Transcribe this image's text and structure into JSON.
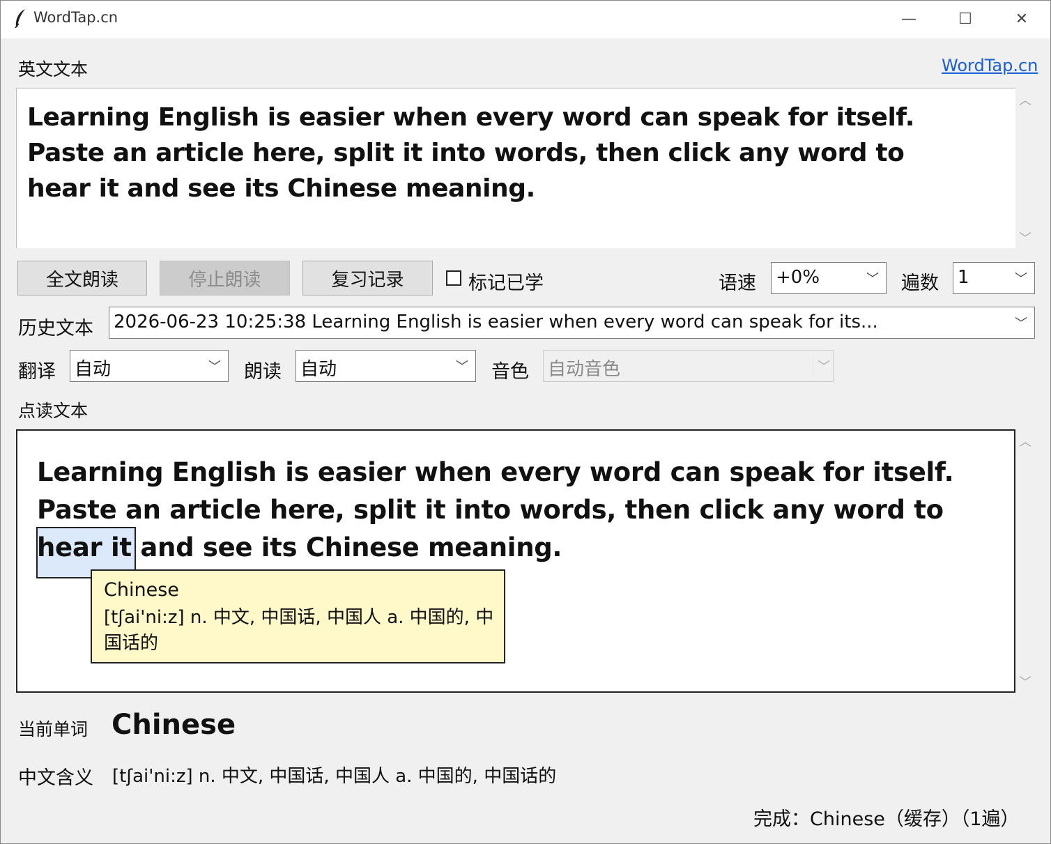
{
  "window": {
    "title": "WordTap.cn",
    "controls": {
      "minimize": "—",
      "maximize": "☐",
      "close": "✕"
    }
  },
  "english_section": {
    "label": "英文文本",
    "link": "WordTap.cn",
    "text": "Learning English is easier when every word can speak for itself. Paste an article here, split it into words, then click any word to hear it and see its Chinese meaning."
  },
  "toolbar": {
    "read_all": "全文朗读",
    "stop_reading": "停止朗读",
    "review_history": "复习记录",
    "mark_learned": "标记已学",
    "mark_learned_checked": false,
    "speed_label": "语速",
    "speed_value": "+0%",
    "repeat_label": "遍数",
    "repeat_value": "1"
  },
  "history": {
    "label": "历史文本",
    "value": "2026-06-23 10:25:38  Learning English is easier when every word can speak for its..."
  },
  "options": {
    "translate_label": "翻译",
    "translate_value": "自动",
    "read_label": "朗读",
    "read_value": "自动",
    "voice_label": "音色",
    "voice_value": "自动音色"
  },
  "reading_section": {
    "label": "点读文本",
    "text_before": "Learning English is easier when every word can speak for itself. Paste an article here, split it into words, then click any word to hear it and see its ",
    "selected_word": "Chinese",
    "text_after": " meaning."
  },
  "tooltip": {
    "word": "Chinese",
    "definition": "[tʃai'ni:z]  n. 中文, 中国话, 中国人  a. 中国的, 中国话的"
  },
  "current_word": {
    "label": "当前单词",
    "value": "Chinese"
  },
  "meaning": {
    "label": "中文含义",
    "value": "[tʃai'ni:z]  n. 中文, 中国话, 中国人  a. 中国的, 中国话的"
  },
  "status": {
    "text": "完成：Chinese（缓存）（1遍）"
  },
  "icons": {
    "app": "feather-icon",
    "scroll_up": "chevron-up-icon",
    "scroll_down": "chevron-down-icon",
    "dropdown": "chevron-down-icon"
  },
  "colors": {
    "link": "#1a5fd6",
    "highlight": "#dbe9fb",
    "tooltip_bg": "#fff8c8",
    "window_bg": "#f0f0f0"
  }
}
